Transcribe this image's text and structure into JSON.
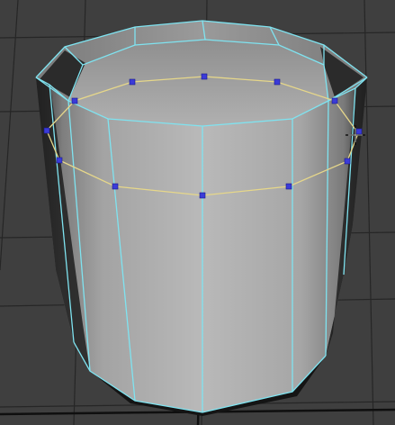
{
  "viewport": {
    "background_color": "#3f3f3f",
    "grid_color": "#1f1f1f",
    "mesh_face_color": "#b4b4b4",
    "mesh_shadow_color": "#4a4a4a",
    "wireframe_color": "#7fe3f0",
    "edge_loop_color": "#e6d78a",
    "vertex_color": "#3b3bd8"
  },
  "mesh": {
    "object": "cylinder-cup",
    "selection": "edge-loop",
    "selected_vertex_count": 12
  },
  "cursor": {
    "icon": "move-crosshair-icon"
  }
}
